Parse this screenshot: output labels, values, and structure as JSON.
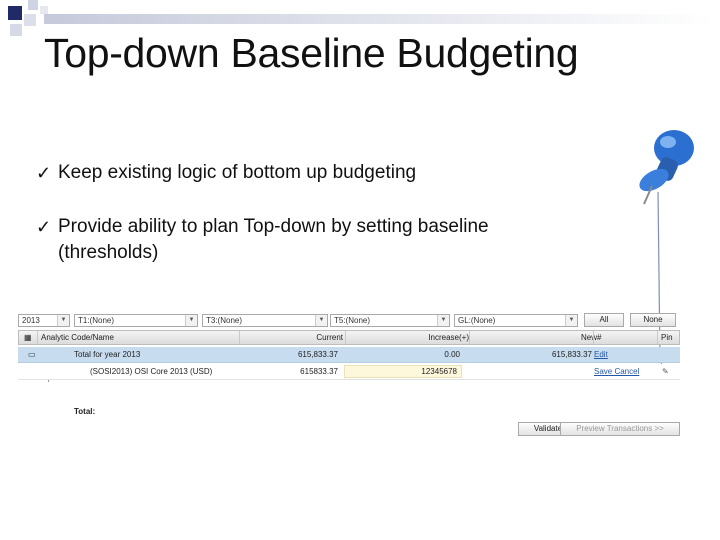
{
  "slide": {
    "title": "Top-down Baseline Budgeting",
    "bullets": [
      "Keep existing logic of bottom up budgeting",
      "Provide ability to plan Top-down by setting baseline (thresholds)"
    ],
    "check_glyph": "✓",
    "colors": {
      "deco_dark": "#1f2a66",
      "deco_light": "#cfd3e3",
      "pin_blue": "#2b6fd0"
    }
  },
  "ui": {
    "filters": {
      "f1_value": "2013",
      "f2_value": "T1:(None)",
      "f3_value": "T3:(None)",
      "f4_value": "T5:(None)",
      "f5_value": "GL:(None)",
      "all_label": "All",
      "none_label": "None"
    },
    "columns": [
      "Analytic Code/Name",
      "Current",
      "Increase(+)",
      "New",
      "#",
      "Pin"
    ],
    "rows": [
      {
        "name": "Total for year 2013",
        "current": "615,833.37",
        "increase": "0.00",
        "new": "615,833.37",
        "action": "Edit"
      },
      {
        "name": "(SOSI2013) OSI Core 2013 (USD)",
        "current": "615833.37",
        "increase": "12345678",
        "new": "",
        "action": "Save Cancel"
      }
    ],
    "total_label": "Total:",
    "validate_label": "Validate",
    "preview_label": "Preview Transactions >>"
  }
}
